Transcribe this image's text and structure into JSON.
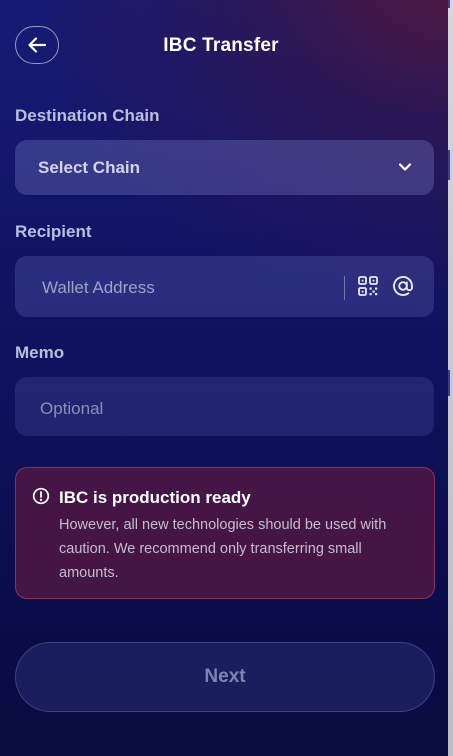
{
  "header": {
    "title": "IBC Transfer",
    "back_icon": "arrow-left-icon"
  },
  "destination": {
    "label": "Destination Chain",
    "selected": "Select Chain",
    "icon": "chevron-down-icon"
  },
  "recipient": {
    "label": "Recipient",
    "placeholder": "Wallet Address",
    "icons": [
      "qr-code-icon",
      "at-sign-icon"
    ]
  },
  "memo": {
    "label": "Memo",
    "placeholder": "Optional"
  },
  "warning": {
    "icon": "alert-circle-icon",
    "title": "IBC is production ready",
    "body": "However, all new technologies should be used with caution. We recommend only transferring small amounts."
  },
  "actions": {
    "next_label": "Next"
  },
  "colors": {
    "background_top": "#171b74",
    "background_bottom": "#080b3e",
    "warning_bg": "#521842",
    "warning_border": "#a03c64",
    "label_text": "#b9bfdc"
  }
}
